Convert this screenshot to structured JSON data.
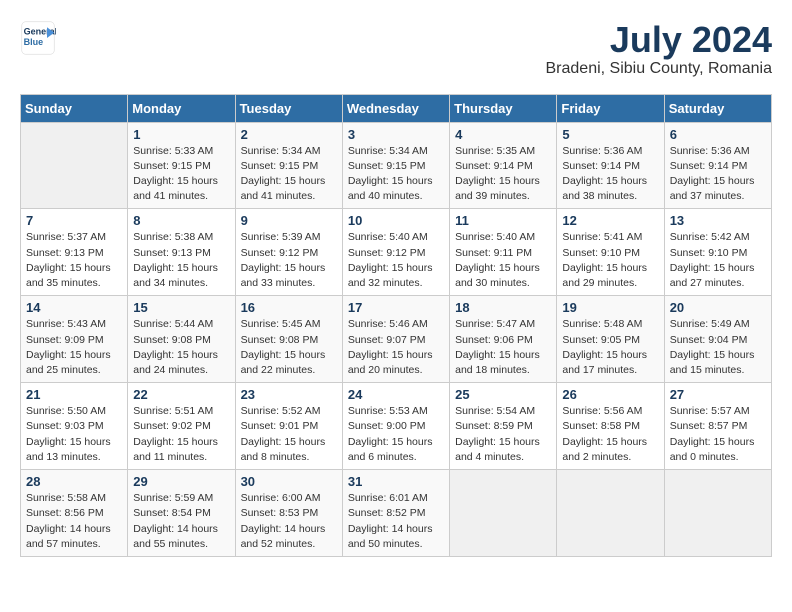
{
  "logo": {
    "line1": "General",
    "line2": "Blue"
  },
  "title": "July 2024",
  "location": "Bradeni, Sibiu County, Romania",
  "weekdays": [
    "Sunday",
    "Monday",
    "Tuesday",
    "Wednesday",
    "Thursday",
    "Friday",
    "Saturday"
  ],
  "weeks": [
    [
      {
        "day": "",
        "info": ""
      },
      {
        "day": "1",
        "info": "Sunrise: 5:33 AM\nSunset: 9:15 PM\nDaylight: 15 hours\nand 41 minutes."
      },
      {
        "day": "2",
        "info": "Sunrise: 5:34 AM\nSunset: 9:15 PM\nDaylight: 15 hours\nand 41 minutes."
      },
      {
        "day": "3",
        "info": "Sunrise: 5:34 AM\nSunset: 9:15 PM\nDaylight: 15 hours\nand 40 minutes."
      },
      {
        "day": "4",
        "info": "Sunrise: 5:35 AM\nSunset: 9:14 PM\nDaylight: 15 hours\nand 39 minutes."
      },
      {
        "day": "5",
        "info": "Sunrise: 5:36 AM\nSunset: 9:14 PM\nDaylight: 15 hours\nand 38 minutes."
      },
      {
        "day": "6",
        "info": "Sunrise: 5:36 AM\nSunset: 9:14 PM\nDaylight: 15 hours\nand 37 minutes."
      }
    ],
    [
      {
        "day": "7",
        "info": "Sunrise: 5:37 AM\nSunset: 9:13 PM\nDaylight: 15 hours\nand 35 minutes."
      },
      {
        "day": "8",
        "info": "Sunrise: 5:38 AM\nSunset: 9:13 PM\nDaylight: 15 hours\nand 34 minutes."
      },
      {
        "day": "9",
        "info": "Sunrise: 5:39 AM\nSunset: 9:12 PM\nDaylight: 15 hours\nand 33 minutes."
      },
      {
        "day": "10",
        "info": "Sunrise: 5:40 AM\nSunset: 9:12 PM\nDaylight: 15 hours\nand 32 minutes."
      },
      {
        "day": "11",
        "info": "Sunrise: 5:40 AM\nSunset: 9:11 PM\nDaylight: 15 hours\nand 30 minutes."
      },
      {
        "day": "12",
        "info": "Sunrise: 5:41 AM\nSunset: 9:10 PM\nDaylight: 15 hours\nand 29 minutes."
      },
      {
        "day": "13",
        "info": "Sunrise: 5:42 AM\nSunset: 9:10 PM\nDaylight: 15 hours\nand 27 minutes."
      }
    ],
    [
      {
        "day": "14",
        "info": "Sunrise: 5:43 AM\nSunset: 9:09 PM\nDaylight: 15 hours\nand 25 minutes."
      },
      {
        "day": "15",
        "info": "Sunrise: 5:44 AM\nSunset: 9:08 PM\nDaylight: 15 hours\nand 24 minutes."
      },
      {
        "day": "16",
        "info": "Sunrise: 5:45 AM\nSunset: 9:08 PM\nDaylight: 15 hours\nand 22 minutes."
      },
      {
        "day": "17",
        "info": "Sunrise: 5:46 AM\nSunset: 9:07 PM\nDaylight: 15 hours\nand 20 minutes."
      },
      {
        "day": "18",
        "info": "Sunrise: 5:47 AM\nSunset: 9:06 PM\nDaylight: 15 hours\nand 18 minutes."
      },
      {
        "day": "19",
        "info": "Sunrise: 5:48 AM\nSunset: 9:05 PM\nDaylight: 15 hours\nand 17 minutes."
      },
      {
        "day": "20",
        "info": "Sunrise: 5:49 AM\nSunset: 9:04 PM\nDaylight: 15 hours\nand 15 minutes."
      }
    ],
    [
      {
        "day": "21",
        "info": "Sunrise: 5:50 AM\nSunset: 9:03 PM\nDaylight: 15 hours\nand 13 minutes."
      },
      {
        "day": "22",
        "info": "Sunrise: 5:51 AM\nSunset: 9:02 PM\nDaylight: 15 hours\nand 11 minutes."
      },
      {
        "day": "23",
        "info": "Sunrise: 5:52 AM\nSunset: 9:01 PM\nDaylight: 15 hours\nand 8 minutes."
      },
      {
        "day": "24",
        "info": "Sunrise: 5:53 AM\nSunset: 9:00 PM\nDaylight: 15 hours\nand 6 minutes."
      },
      {
        "day": "25",
        "info": "Sunrise: 5:54 AM\nSunset: 8:59 PM\nDaylight: 15 hours\nand 4 minutes."
      },
      {
        "day": "26",
        "info": "Sunrise: 5:56 AM\nSunset: 8:58 PM\nDaylight: 15 hours\nand 2 minutes."
      },
      {
        "day": "27",
        "info": "Sunrise: 5:57 AM\nSunset: 8:57 PM\nDaylight: 15 hours\nand 0 minutes."
      }
    ],
    [
      {
        "day": "28",
        "info": "Sunrise: 5:58 AM\nSunset: 8:56 PM\nDaylight: 14 hours\nand 57 minutes."
      },
      {
        "day": "29",
        "info": "Sunrise: 5:59 AM\nSunset: 8:54 PM\nDaylight: 14 hours\nand 55 minutes."
      },
      {
        "day": "30",
        "info": "Sunrise: 6:00 AM\nSunset: 8:53 PM\nDaylight: 14 hours\nand 52 minutes."
      },
      {
        "day": "31",
        "info": "Sunrise: 6:01 AM\nSunset: 8:52 PM\nDaylight: 14 hours\nand 50 minutes."
      },
      {
        "day": "",
        "info": ""
      },
      {
        "day": "",
        "info": ""
      },
      {
        "day": "",
        "info": ""
      }
    ]
  ]
}
